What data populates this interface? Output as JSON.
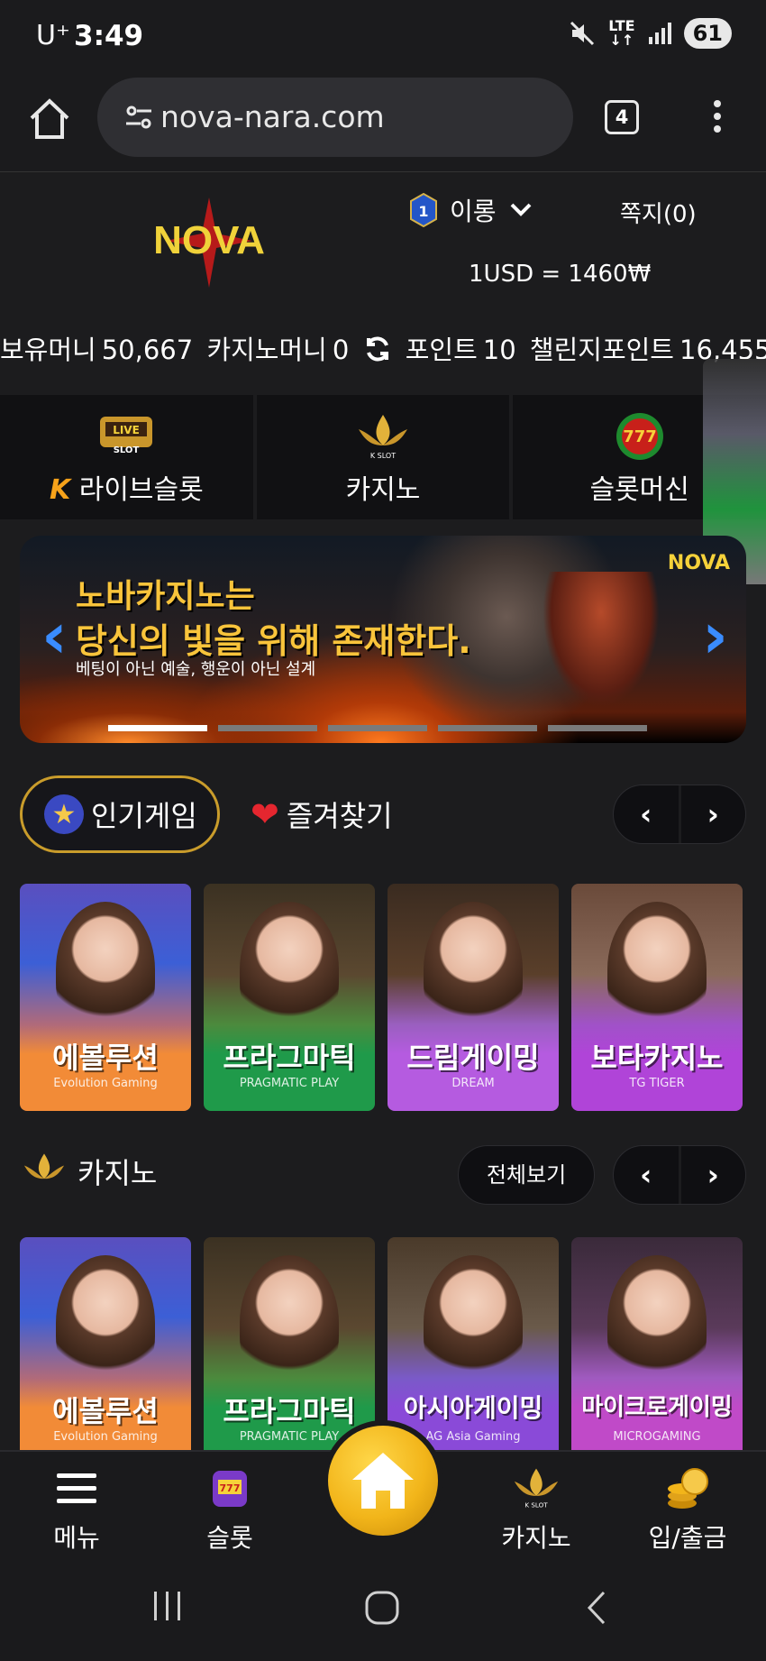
{
  "status_bar": {
    "carrier": "U⁺",
    "time": "3:49",
    "network": "LTE",
    "battery": "61"
  },
  "browser": {
    "url": "nova-nara.com",
    "tab_count": "4"
  },
  "header": {
    "logo_text": "NOVA",
    "user_level": "1",
    "user_name": "이롱",
    "messages": "쪽지(0)",
    "exchange_rate": "1USD = 1460₩"
  },
  "balances": {
    "money_label": "보유머니",
    "money_value": "50,667",
    "casino_label": "카지노머니",
    "casino_value": "0",
    "point_label": "포인트",
    "point_value": "10",
    "challenge_label": "챌린지포인트",
    "challenge_value": "16,455"
  },
  "categories": [
    {
      "label": "라이브슬롯",
      "icon": "live-slot-icon"
    },
    {
      "label": "카지노",
      "icon": "kslot-icon"
    },
    {
      "label": "슬롯머신",
      "icon": "777-slots-icon"
    }
  ],
  "banner": {
    "line1": "노바카지노는",
    "line2": "당신의 빛을 위해 존재한다.",
    "line3": "베팅이 아닌 예술, 행운이 아닌 설계",
    "logo": "NOVA",
    "slide_count": 5,
    "active_slide": 1
  },
  "section_tabs": {
    "popular": "인기게임",
    "favorites": "즐겨찾기"
  },
  "popular_games": [
    {
      "name": "에볼루션",
      "brand": "Evolution Gaming",
      "theme": "evo"
    },
    {
      "name": "프라그마틱",
      "brand": "PRAGMATIC PLAY",
      "theme": "prag"
    },
    {
      "name": "드림게이밍",
      "brand": "DREAM",
      "theme": "dream"
    },
    {
      "name": "보타카지노",
      "brand": "TG TIGER",
      "theme": "bota"
    }
  ],
  "casino_section": {
    "title": "카지노",
    "view_all": "전체보기"
  },
  "casino_games": [
    {
      "name": "에볼루션",
      "brand": "Evolution Gaming",
      "theme": "evo"
    },
    {
      "name": "프라그마틱",
      "brand": "PRAGMATIC PLAY",
      "theme": "prag"
    },
    {
      "name": "아시아게이밍",
      "brand": "AG Asia Gaming",
      "theme": "asia"
    },
    {
      "name": "마이크로게이밍",
      "brand": "MICROGAMING",
      "theme": "micro"
    }
  ],
  "bottom_nav": {
    "menu": "메뉴",
    "slot": "슬롯",
    "casino": "카지노",
    "deposit": "입/출금"
  },
  "colors": {
    "accent_gold": "#f2b51a",
    "banner_arrow": "#3a8cff",
    "heart": "#e5262f"
  }
}
